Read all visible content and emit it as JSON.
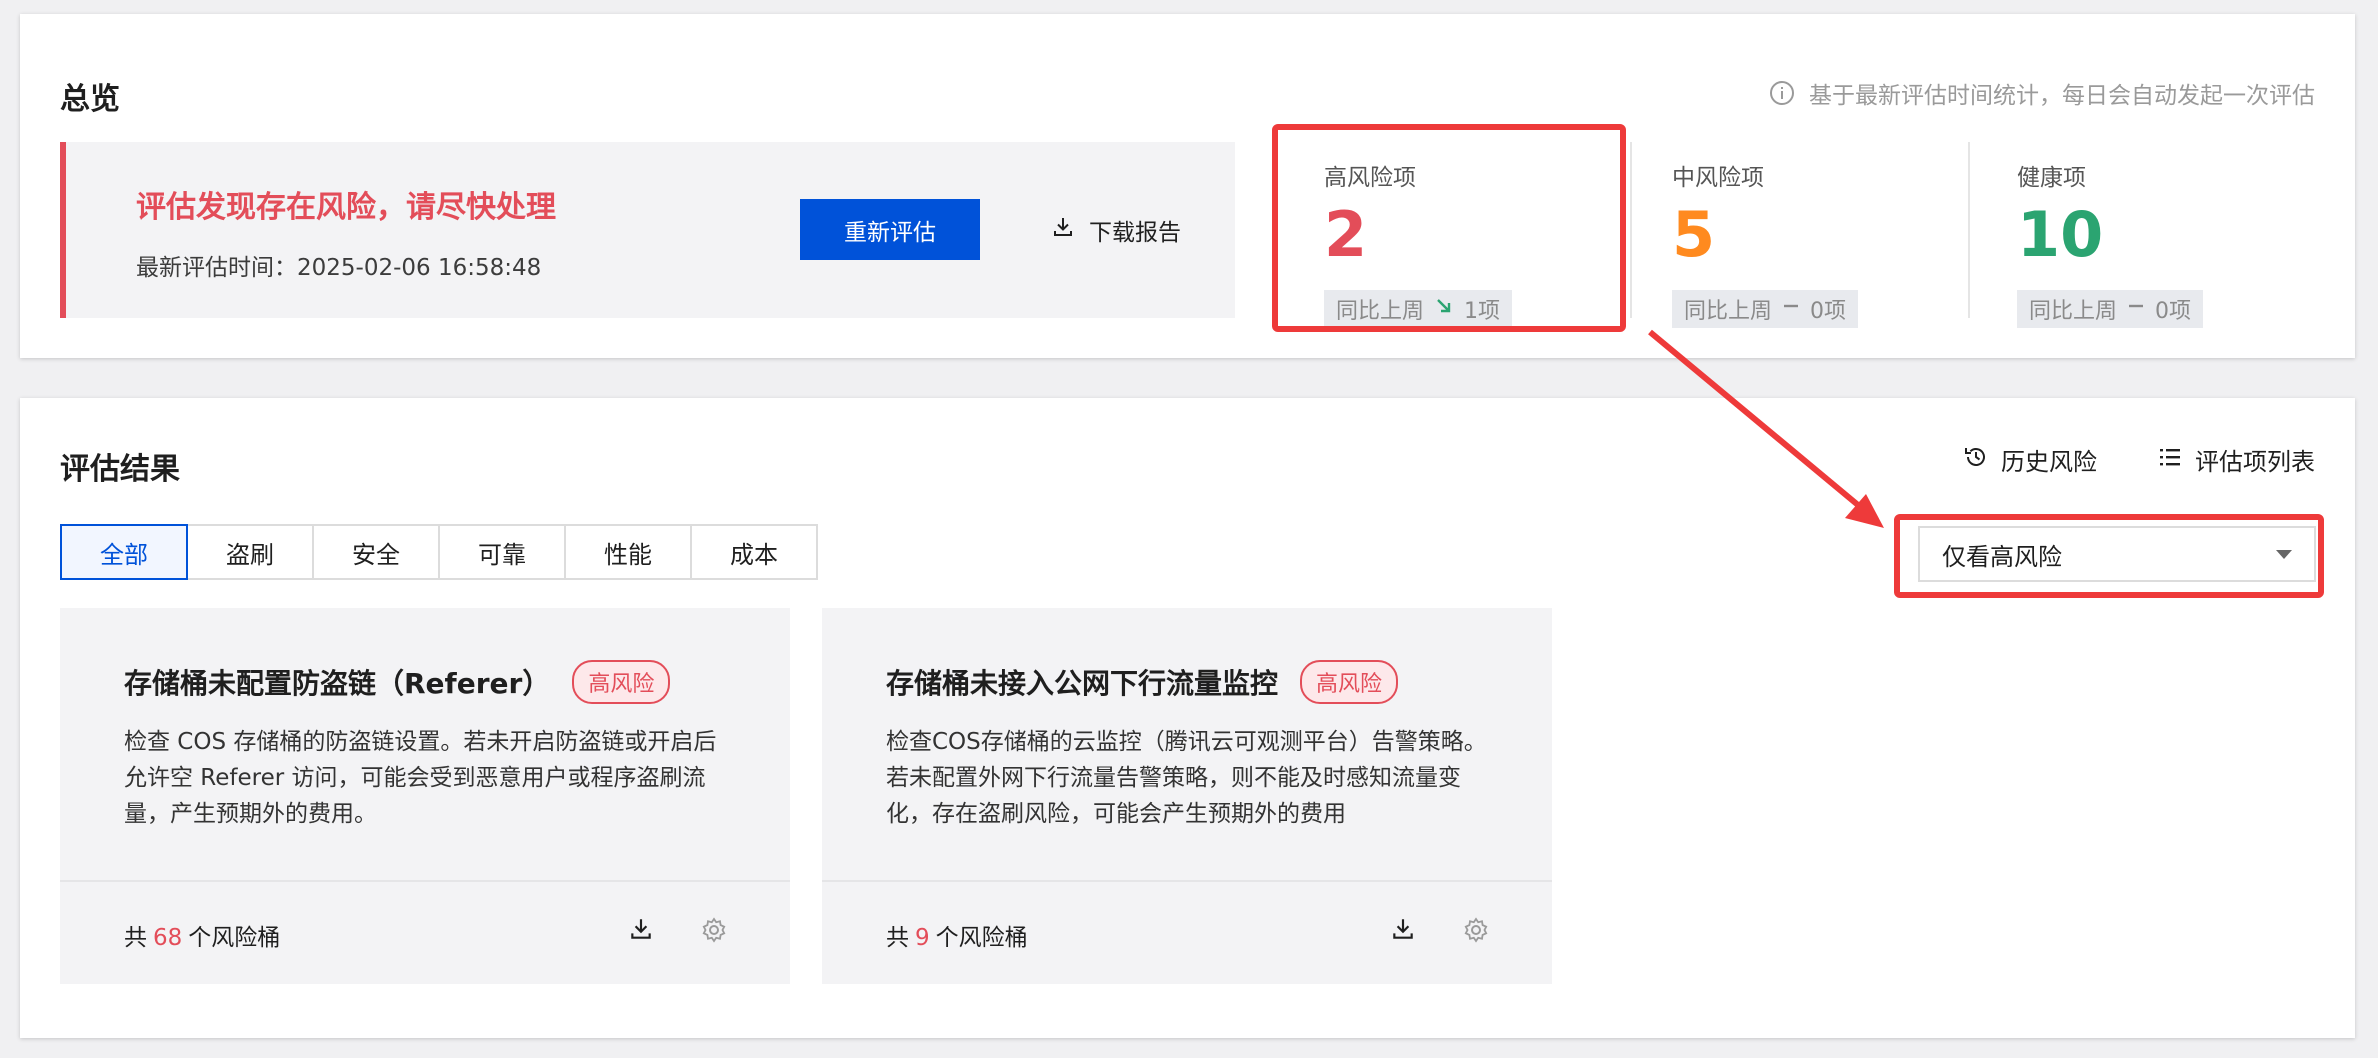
{
  "overview": {
    "title": "总览",
    "hint": "基于最新评估时间统计，每日会自动发起一次评估",
    "alert": {
      "title": "评估发现存在风险，请尽快处理",
      "time_label": "最新评估时间：2025-02-06 16:58:48",
      "rerun_button": "重新评估",
      "download_button": "下载报告"
    },
    "stats": [
      {
        "label": "高风险项",
        "value": "2",
        "compare": "同比上周",
        "delta": "1项",
        "trend": "down",
        "color": "#e34d59"
      },
      {
        "label": "中风险项",
        "value": "5",
        "compare": "同比上周",
        "delta": "0项",
        "trend": "flat",
        "color": "#ff8a1f"
      },
      {
        "label": "健康项",
        "value": "10",
        "compare": "同比上周",
        "delta": "0项",
        "trend": "flat",
        "color": "#2ba471"
      }
    ]
  },
  "results": {
    "title": "评估结果",
    "actions": {
      "history": "历史风险",
      "list": "评估项列表"
    },
    "tabs": [
      "全部",
      "盗刷",
      "安全",
      "可靠",
      "性能",
      "成本"
    ],
    "active_tab": "全部",
    "filter": {
      "selected": "仅看高风险"
    },
    "cards": [
      {
        "title": "存储桶未配置防盗链（Referer）",
        "badge": "高风险",
        "desc": "检查 COS 存储桶的防盗链设置。若未开启防盗链或开启后允许空 Referer 访问，可能会受到恶意用户或程序盗刷流量，产生预期外的费用。",
        "foot_prefix": "共",
        "count": "68",
        "foot_suffix": "个风险桶"
      },
      {
        "title": "存储桶未接入公网下行流量监控",
        "badge": "高风险",
        "desc": "检查COS存储桶的云监控（腾讯云可观测平台）告警策略。若未配置外网下行流量告警策略，则不能及时感知流量变化，存在盗刷风险，可能会产生预期外的费用",
        "foot_prefix": "共",
        "count": "9",
        "foot_suffix": "个风险桶"
      }
    ]
  },
  "colors": {
    "primary": "#0052d9",
    "danger": "#e34d59",
    "warning": "#ff8a1f",
    "success": "#2ba471",
    "annotation": "#ee3a3a"
  },
  "icons": [
    "info-icon",
    "download-icon",
    "trend-down-icon",
    "history-icon",
    "list-icon",
    "chevron-down-icon",
    "settings-icon"
  ]
}
